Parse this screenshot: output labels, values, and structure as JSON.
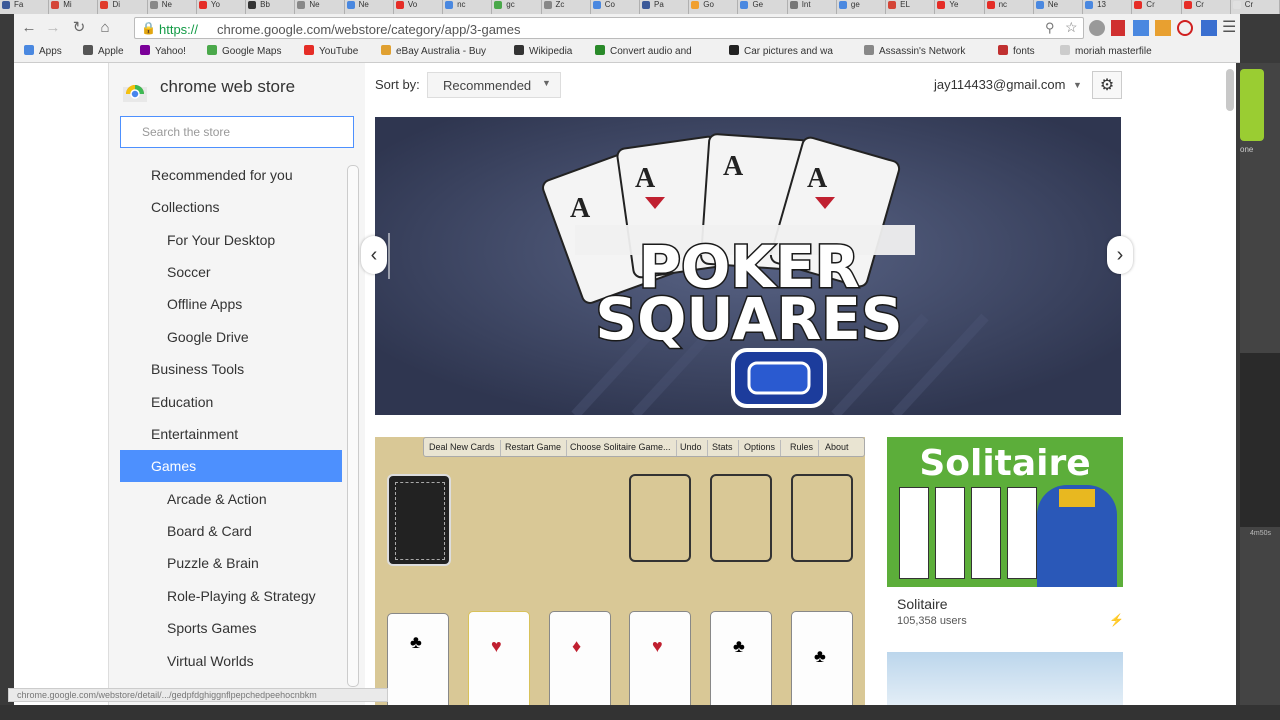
{
  "tabs": [
    {
      "label": "Fa",
      "color": "#3b5998"
    },
    {
      "label": "Mi",
      "color": "#d44638"
    },
    {
      "label": "Di",
      "color": "#e03b2a"
    },
    {
      "label": "Ne",
      "color": "#888"
    },
    {
      "label": "Yo",
      "color": "#e52d27"
    },
    {
      "label": "Bb",
      "color": "#333"
    },
    {
      "label": "Ne",
      "color": "#888"
    },
    {
      "label": "Ne",
      "color": "#4a88e0"
    },
    {
      "label": "Vo",
      "color": "#e52d27"
    },
    {
      "label": "nc",
      "color": "#4a88e0"
    },
    {
      "label": "gc",
      "color": "#4aa84a"
    },
    {
      "label": "Zc",
      "color": "#888"
    },
    {
      "label": "Co",
      "color": "#4a88e0"
    },
    {
      "label": "Pa",
      "color": "#3b5998"
    },
    {
      "label": "Go",
      "color": "#f0a030"
    },
    {
      "label": "Ge",
      "color": "#4a88e0"
    },
    {
      "label": "Int",
      "color": "#777"
    },
    {
      "label": "ge",
      "color": "#4a88e0"
    },
    {
      "label": "EL",
      "color": "#d44638"
    },
    {
      "label": "Ye",
      "color": "#e52d27"
    },
    {
      "label": "nc",
      "color": "#e52d27"
    },
    {
      "label": "Ne",
      "color": "#4a88e0"
    },
    {
      "label": "13",
      "color": "#4a88e0"
    },
    {
      "label": "Cr",
      "color": "#e52d27"
    },
    {
      "label": "Cr",
      "color": "#e52d27"
    },
    {
      "label": "Cr",
      "color": "#e0e0e0"
    }
  ],
  "url": {
    "scheme": "https://",
    "rest": "chrome.google.com/webstore/category/app/3-games"
  },
  "bookmarks": [
    {
      "label": "Apps",
      "color": "#4a88e0"
    },
    {
      "label": "Apple",
      "color": "#555"
    },
    {
      "label": "Yahoo!",
      "color": "#7b0099"
    },
    {
      "label": "Google Maps",
      "color": "#4aa84a"
    },
    {
      "label": "YouTube",
      "color": "#e52d27"
    },
    {
      "label": "eBay Australia - Buy",
      "color": "#e0a030"
    },
    {
      "label": "Wikipedia",
      "color": "#333"
    },
    {
      "label": "Convert audio and",
      "color": "#2a8a2a"
    },
    {
      "label": "Car pictures and wa",
      "color": "#222"
    },
    {
      "label": "Assassin's Network",
      "color": "#888"
    },
    {
      "label": "fonts",
      "color": "#c03030"
    },
    {
      "label": "moriah masterfile",
      "color": "#ccc"
    }
  ],
  "store": {
    "name": "chrome web store",
    "search_placeholder": "Search the store"
  },
  "nav": {
    "recommended": "Recommended for you",
    "collections": "Collections",
    "collection_items": [
      "For Your Desktop",
      "Soccer",
      "Offline Apps",
      "Google Drive"
    ],
    "business": "Business Tools",
    "education": "Education",
    "entertainment": "Entertainment",
    "games": "Games",
    "game_items": [
      "Arcade & Action",
      "Board & Card",
      "Puzzle & Brain",
      "Role-Playing & Strategy",
      "Sports Games",
      "Virtual Worlds"
    ]
  },
  "sort": {
    "label": "Sort by:",
    "value": "Recommended"
  },
  "account": {
    "email": "jay114433@gmail.com"
  },
  "banner": {
    "title_line1": "POKER",
    "title_line2": "SQUARES"
  },
  "solitaire_toolbar": [
    "Deal New Cards",
    "Restart Game",
    "Choose Solitaire Game...",
    "Undo",
    "Stats",
    "Options",
    "Rules",
    "About"
  ],
  "tile2": {
    "art_title": "Solitaire",
    "name": "Solitaire",
    "users": "105,358 users"
  },
  "status_url": "chrome.google.com/webstore/detail/.../gedpfdghiggnflpepchedpeehocnbkm",
  "side_label": "one",
  "side_time": "4m50s"
}
